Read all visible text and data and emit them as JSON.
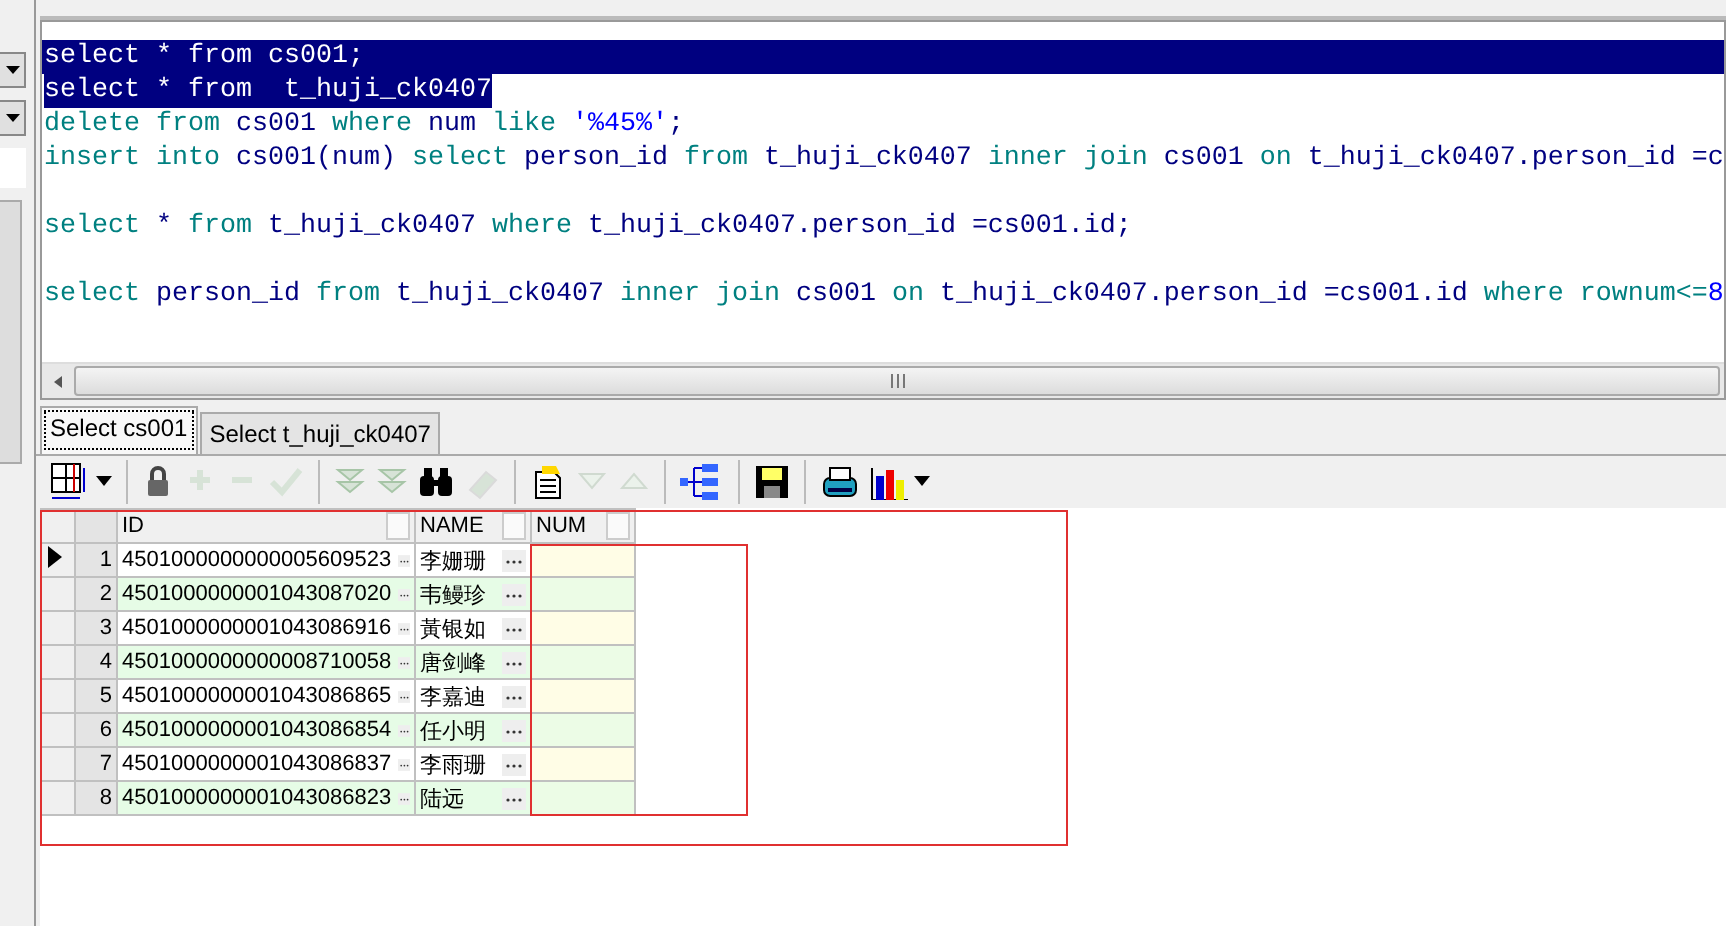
{
  "editor": {
    "lines": [
      {
        "kind": "code",
        "selected": true,
        "tokens": [
          {
            "text": "select",
            "kind": "kw"
          },
          {
            "text": " * ",
            "kind": "id"
          },
          {
            "text": "from",
            "kind": "kw"
          },
          {
            "text": " cs001;",
            "kind": "id"
          }
        ]
      },
      {
        "kind": "code",
        "selected": true,
        "tokens": [
          {
            "text": "select",
            "kind": "kw"
          },
          {
            "text": " * ",
            "kind": "id"
          },
          {
            "text": "from",
            "kind": "kw"
          },
          {
            "text": "  t_huji_ck0407",
            "kind": "id"
          }
        ]
      },
      {
        "kind": "code",
        "selected": false,
        "tokens": [
          {
            "text": "delete from",
            "kind": "kw"
          },
          {
            "text": " cs001 ",
            "kind": "id"
          },
          {
            "text": "where",
            "kind": "kw"
          },
          {
            "text": " num ",
            "kind": "id"
          },
          {
            "text": "like",
            "kind": "kw"
          },
          {
            "text": " '%45%'",
            "kind": "str"
          },
          {
            "text": ";",
            "kind": "id"
          }
        ]
      },
      {
        "kind": "code",
        "selected": false,
        "tokens": [
          {
            "text": "insert into",
            "kind": "kw"
          },
          {
            "text": " cs001(num) ",
            "kind": "id"
          },
          {
            "text": "select",
            "kind": "kw"
          },
          {
            "text": " person_id ",
            "kind": "id"
          },
          {
            "text": "from",
            "kind": "kw"
          },
          {
            "text": " t_huji_ck0407 ",
            "kind": "id"
          },
          {
            "text": "inner join",
            "kind": "kw"
          },
          {
            "text": " cs001 ",
            "kind": "id"
          },
          {
            "text": "on",
            "kind": "kw"
          },
          {
            "text": " t_huji_ck0407.person_id =c",
            "kind": "id"
          }
        ]
      },
      {
        "kind": "blank"
      },
      {
        "kind": "code",
        "selected": false,
        "tokens": [
          {
            "text": "select",
            "kind": "kw"
          },
          {
            "text": " * ",
            "kind": "id"
          },
          {
            "text": "from",
            "kind": "kw"
          },
          {
            "text": " t_huji_ck0407 ",
            "kind": "id"
          },
          {
            "text": "where",
            "kind": "kw"
          },
          {
            "text": " t_huji_ck0407.person_id =cs001.id;",
            "kind": "id"
          }
        ]
      },
      {
        "kind": "blank"
      },
      {
        "kind": "code",
        "selected": false,
        "tokens": [
          {
            "text": "select",
            "kind": "kw"
          },
          {
            "text": " person_id ",
            "kind": "id"
          },
          {
            "text": "from",
            "kind": "kw"
          },
          {
            "text": " t_huji_ck0407 ",
            "kind": "id"
          },
          {
            "text": "inner join",
            "kind": "kw"
          },
          {
            "text": " cs001 ",
            "kind": "id"
          },
          {
            "text": "on",
            "kind": "kw"
          },
          {
            "text": " t_huji_ck0407.person_id =cs001.id ",
            "kind": "id"
          },
          {
            "text": "where",
            "kind": "kw"
          },
          {
            "text": " rownum<=",
            "kind": "kw"
          },
          {
            "text": "8",
            "kind": "str"
          }
        ]
      }
    ]
  },
  "result_tabs": [
    {
      "label": "Select cs001",
      "selected": true
    },
    {
      "label": "Select t_huji_ck0407",
      "selected": false
    }
  ],
  "toolbar": [
    {
      "kind": "grid",
      "disabled": false
    },
    {
      "kind": "sep"
    },
    {
      "kind": "lock",
      "disabled": false
    },
    {
      "kind": "plus",
      "disabled": true
    },
    {
      "kind": "minus",
      "disabled": true
    },
    {
      "kind": "check",
      "disabled": true
    },
    {
      "kind": "sep"
    },
    {
      "kind": "down2",
      "disabled": true
    },
    {
      "kind": "down2",
      "disabled": true
    },
    {
      "kind": "find",
      "disabled": false
    },
    {
      "kind": "eraser",
      "disabled": true
    },
    {
      "kind": "sep"
    },
    {
      "kind": "doc",
      "disabled": false
    },
    {
      "kind": "down",
      "disabled": true
    },
    {
      "kind": "up",
      "disabled": true
    },
    {
      "kind": "sep"
    },
    {
      "kind": "tree",
      "disabled": false
    },
    {
      "kind": "sep"
    },
    {
      "kind": "save",
      "disabled": false
    },
    {
      "kind": "sep"
    },
    {
      "kind": "print",
      "disabled": false
    },
    {
      "kind": "chart",
      "disabled": false
    }
  ],
  "table": {
    "columns": [
      "ID",
      "NAME",
      "NUM"
    ],
    "rows": [
      {
        "number": "1",
        "selected": true,
        "id": "4501000000000005609523",
        "name": "李姗珊"
      },
      {
        "number": "2",
        "selected": false,
        "id": "4501000000001043087020",
        "name": "韦鳗珍"
      },
      {
        "number": "3",
        "selected": false,
        "id": "4501000000001043086916",
        "name": "黃银如"
      },
      {
        "number": "4",
        "selected": false,
        "id": "4501000000000008710058",
        "name": "唐剑峰"
      },
      {
        "number": "5",
        "selected": false,
        "id": "4501000000001043086865",
        "name": "李嘉迪"
      },
      {
        "number": "6",
        "selected": false,
        "id": "4501000000001043086854",
        "name": "任小明"
      },
      {
        "number": "7",
        "selected": false,
        "id": "4501000000001043086837",
        "name": "李雨珊"
      },
      {
        "number": "8",
        "selected": false,
        "id": "4501000000001043086823",
        "name": "陆远"
      }
    ]
  }
}
